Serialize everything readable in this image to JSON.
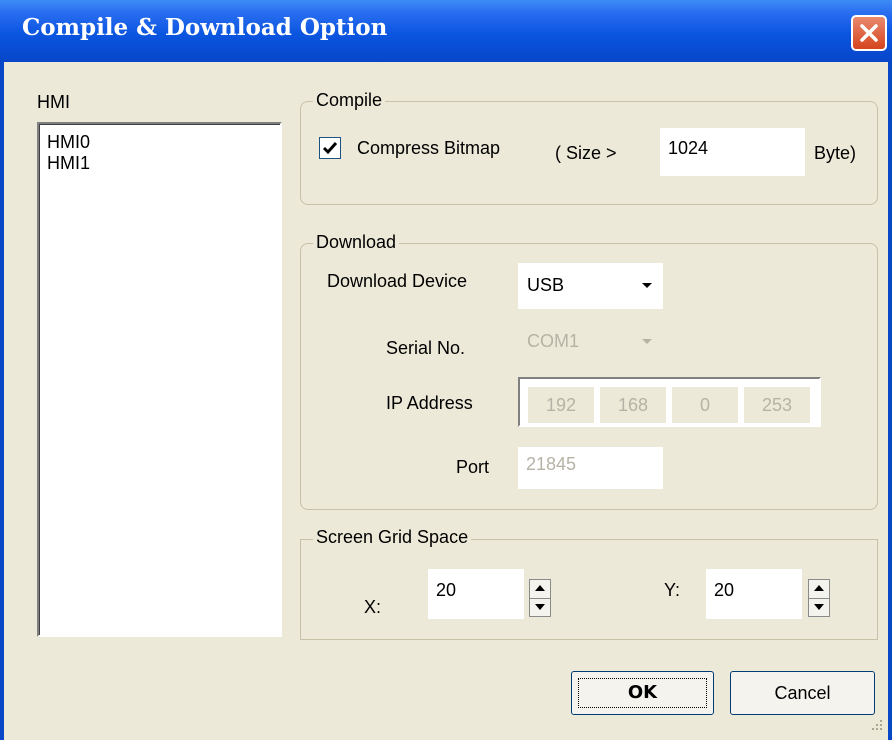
{
  "window": {
    "title": "Compile & Download Option"
  },
  "hmi_list": {
    "label": "HMI",
    "items": [
      "HMI0",
      "HMI1"
    ]
  },
  "compile": {
    "legend": "Compile",
    "compress_bitmap_label": "Compress Bitmap",
    "compress_bitmap_checked": true,
    "size_prefix": "( Size >",
    "size_value": "1024",
    "size_suffix": "Byte)"
  },
  "download": {
    "legend": "Download",
    "device_label": "Download Device",
    "device_value": "USB",
    "serial_label": "Serial No.",
    "serial_value": "COM1",
    "ip_label": "IP Address",
    "ip_octets": [
      "192",
      "168",
      "0",
      "253"
    ],
    "port_label": "Port",
    "port_value": "21845"
  },
  "grid": {
    "legend": "Screen Grid Space",
    "x_label": "X:",
    "x_value": "20",
    "y_label": "Y:",
    "y_value": "20"
  },
  "buttons": {
    "ok": "OK",
    "cancel": "Cancel"
  },
  "colors": {
    "titlebar": "#0a55e0",
    "dialog_bg": "#ece9d8",
    "close_button": "#d5431d"
  }
}
